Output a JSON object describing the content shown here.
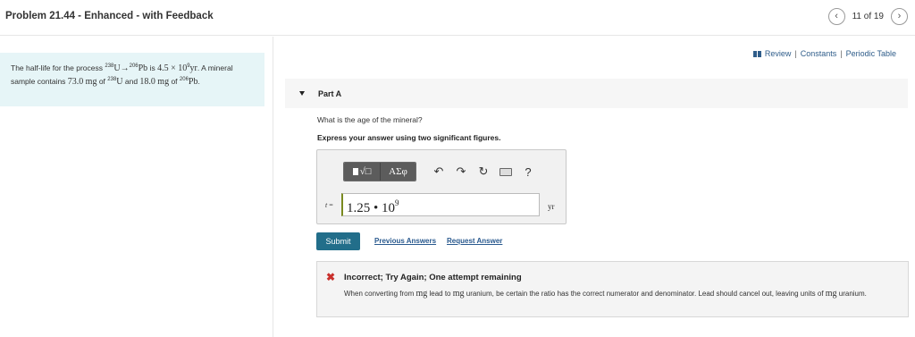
{
  "header": {
    "title": "Problem 21.44 - Enhanced - with Feedback",
    "prev_icon": "chevron-left-icon",
    "next_icon": "chevron-right-icon",
    "position": "11 of 19"
  },
  "problem": {
    "prefix": "The half-life for the process ",
    "iso1_mass": "238",
    "iso1_symbol": "U",
    "arrow": "→",
    "iso2_mass": "206",
    "iso2_symbol": "Pb",
    "middle": " is ",
    "halflife_mantissa": "4.5 × 10",
    "halflife_exp": "9",
    "halflife_unit": "yr",
    "sentence_end": ". A mineral sample contains ",
    "mass1": "73.0",
    "unit_mg_1": "mg",
    "of1": " of ",
    "iso3_mass": "238",
    "iso3_symbol": "U",
    "and": " and ",
    "mass2": "18.0",
    "unit_mg_2": "mg",
    "of2": " of ",
    "iso4_mass": "206",
    "iso4_symbol": "Pb",
    "period": "."
  },
  "links": {
    "review": "Review",
    "sep": "|",
    "constants": "Constants",
    "periodic": "Periodic Table"
  },
  "part": {
    "label": "Part A",
    "question": "What is the age of the mineral?",
    "instruction": "Express your answer using two significant figures."
  },
  "toolbar": {
    "templates_label": "√□",
    "symbols_label": "ΑΣφ",
    "undo_icon": "undo-icon",
    "redo_icon": "redo-icon",
    "reset_icon": "reset-icon",
    "keyboard_icon": "keyboard-icon",
    "help_label": "?"
  },
  "answer": {
    "variable": "t",
    "equals": " =",
    "mantissa": "1.25 • 10",
    "exponent": "9",
    "unit": "yr"
  },
  "actions": {
    "submit": "Submit",
    "previous_answers": "Previous Answers",
    "request_answer": "Request Answer"
  },
  "feedback": {
    "status_color": "#c9302c",
    "title": "Incorrect; Try Again; One attempt remaining",
    "body_1": "When converting from ",
    "mg_a": "mg",
    "body_2": " lead to ",
    "mg_b": "mg",
    "body_3": " uranium, be certain the ratio has the correct numerator and denominator. Lead should cancel out, leaving units of ",
    "mg_c": "mg",
    "body_4": " uranium."
  }
}
